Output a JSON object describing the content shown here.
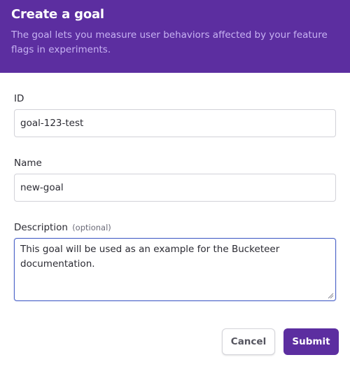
{
  "header": {
    "title": "Create a goal",
    "description": "The goal lets you measure user behaviors affected by your feature flags in experiments."
  },
  "form": {
    "id": {
      "label": "ID",
      "value": "goal-123-test"
    },
    "name": {
      "label": "Name",
      "value": "new-goal"
    },
    "description": {
      "label": "Description",
      "optional_hint": "(optional)",
      "value": "This goal will be used as an example for the Bucketeer documentation."
    }
  },
  "actions": {
    "cancel_label": "Cancel",
    "submit_label": "Submit"
  },
  "colors": {
    "brand": "#5c2ea0",
    "focus_border": "#4c64c8"
  }
}
